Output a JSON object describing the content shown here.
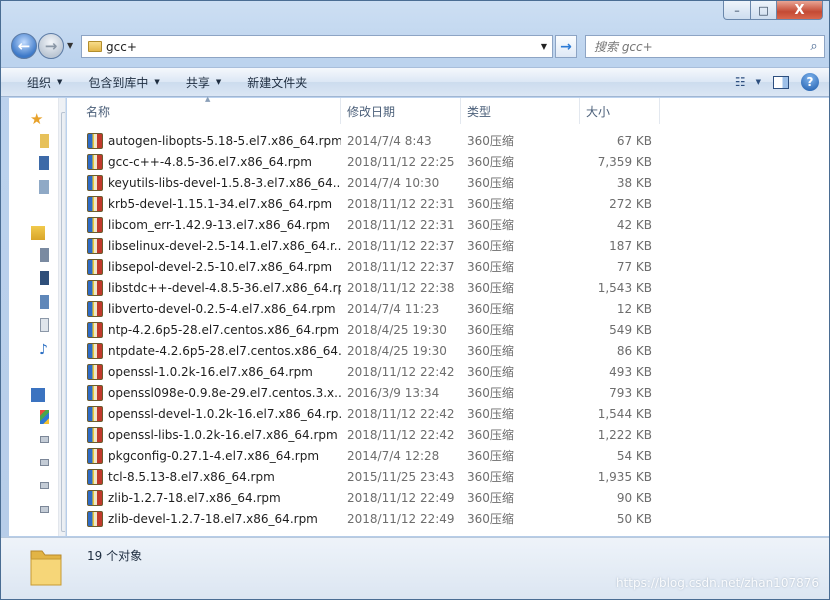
{
  "window": {
    "controls": {
      "minimize": "–",
      "maximize": "□",
      "close": "X"
    }
  },
  "nav": {
    "back_icon": "back-arrow-icon",
    "forward_icon": "forward-arrow-icon",
    "address": "gcc+",
    "go_icon": "go-arrow-icon",
    "search_placeholder": "搜索 gcc+"
  },
  "toolbar": {
    "organize": "组织",
    "include_in_library": "包含到库中",
    "share": "共享",
    "new_folder": "新建文件夹"
  },
  "columns": {
    "name": "名称",
    "date": "修改日期",
    "type": "类型",
    "size": "大小"
  },
  "files": [
    {
      "name": "autogen-libopts-5.18-5.el7.x86_64.rpm",
      "date": "2014/7/4 8:43",
      "type": "360压缩",
      "size": "67 KB"
    },
    {
      "name": "gcc-c++-4.8.5-36.el7.x86_64.rpm",
      "date": "2018/11/12 22:25",
      "type": "360压缩",
      "size": "7,359 KB"
    },
    {
      "name": "keyutils-libs-devel-1.5.8-3.el7.x86_64....",
      "date": "2014/7/4 10:30",
      "type": "360压缩",
      "size": "38 KB"
    },
    {
      "name": "krb5-devel-1.15.1-34.el7.x86_64.rpm",
      "date": "2018/11/12 22:31",
      "type": "360压缩",
      "size": "272 KB"
    },
    {
      "name": "libcom_err-1.42.9-13.el7.x86_64.rpm",
      "date": "2018/11/12 22:31",
      "type": "360压缩",
      "size": "42 KB"
    },
    {
      "name": "libselinux-devel-2.5-14.1.el7.x86_64.r...",
      "date": "2018/11/12 22:37",
      "type": "360压缩",
      "size": "187 KB"
    },
    {
      "name": "libsepol-devel-2.5-10.el7.x86_64.rpm",
      "date": "2018/11/12 22:37",
      "type": "360压缩",
      "size": "77 KB"
    },
    {
      "name": "libstdc++-devel-4.8.5-36.el7.x86_64.rpm",
      "date": "2018/11/12 22:38",
      "type": "360压缩",
      "size": "1,543 KB"
    },
    {
      "name": "libverto-devel-0.2.5-4.el7.x86_64.rpm",
      "date": "2014/7/4 11:23",
      "type": "360压缩",
      "size": "12 KB"
    },
    {
      "name": "ntp-4.2.6p5-28.el7.centos.x86_64.rpm",
      "date": "2018/4/25 19:30",
      "type": "360压缩",
      "size": "549 KB"
    },
    {
      "name": "ntpdate-4.2.6p5-28.el7.centos.x86_64....",
      "date": "2018/4/25 19:30",
      "type": "360压缩",
      "size": "86 KB"
    },
    {
      "name": "openssl-1.0.2k-16.el7.x86_64.rpm",
      "date": "2018/11/12 22:42",
      "type": "360压缩",
      "size": "493 KB"
    },
    {
      "name": "openssl098e-0.9.8e-29.el7.centos.3.x...",
      "date": "2016/3/9 13:34",
      "type": "360压缩",
      "size": "793 KB"
    },
    {
      "name": "openssl-devel-1.0.2k-16.el7.x86_64.rp...",
      "date": "2018/11/12 22:42",
      "type": "360压缩",
      "size": "1,544 KB"
    },
    {
      "name": "openssl-libs-1.0.2k-16.el7.x86_64.rpm",
      "date": "2018/11/12 22:42",
      "type": "360压缩",
      "size": "1,222 KB"
    },
    {
      "name": "pkgconfig-0.27.1-4.el7.x86_64.rpm",
      "date": "2014/7/4 12:28",
      "type": "360压缩",
      "size": "54 KB"
    },
    {
      "name": "tcl-8.5.13-8.el7.x86_64.rpm",
      "date": "2015/11/25 23:43",
      "type": "360压缩",
      "size": "1,935 KB"
    },
    {
      "name": "zlib-1.2.7-18.el7.x86_64.rpm",
      "date": "2018/11/12 22:49",
      "type": "360压缩",
      "size": "90 KB"
    },
    {
      "name": "zlib-devel-1.2.7-18.el7.x86_64.rpm",
      "date": "2018/11/12 22:49",
      "type": "360压缩",
      "size": "50 KB"
    }
  ],
  "status": {
    "count": "19 个对象",
    "watermark": "https://blog.csdn.net/zhan107876"
  },
  "colors": {
    "accent": "#2c7bd6",
    "archive_icon_blue": "#2f6bc4",
    "archive_icon_yellow": "#e8c83b",
    "archive_icon_red": "#c0392b",
    "close_button": "#c44a34"
  }
}
